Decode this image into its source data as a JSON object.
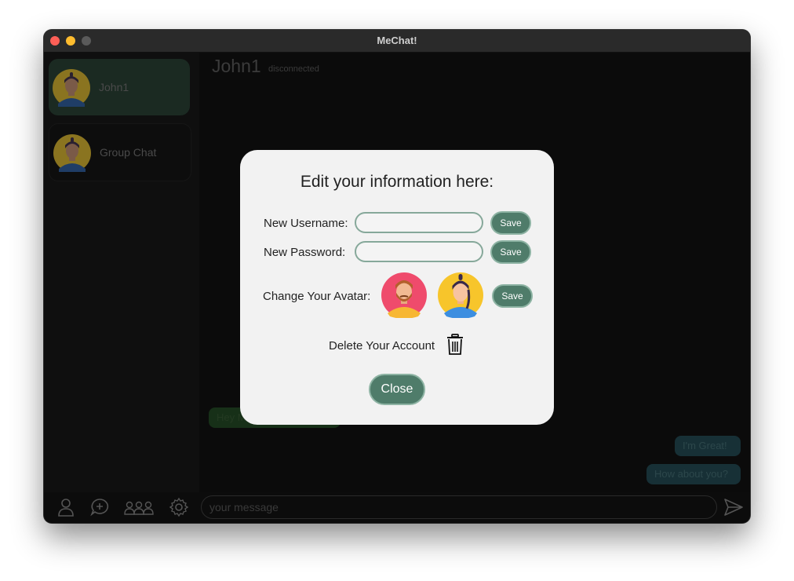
{
  "window": {
    "title": "MeChat!"
  },
  "sidebar": {
    "contacts": [
      {
        "label": "John1",
        "avatar": "man-ponytail-blue-shirt-avatar"
      },
      {
        "label": "Group Chat",
        "avatar": "man-ponytail-blue-shirt-avatar"
      }
    ]
  },
  "chat": {
    "name": "John1",
    "status": "disconnected",
    "messages": [
      {
        "text": "Hey M",
        "direction": "incoming"
      },
      {
        "text": "I'm Great!",
        "direction": "outgoing"
      },
      {
        "text": "How about you?",
        "direction": "outgoing"
      }
    ]
  },
  "bottom_bar": {
    "icons": [
      "person-icon",
      "new-chat-icon",
      "group-icon",
      "settings-gear-icon"
    ],
    "message_placeholder": "your message",
    "send_icon": "send-icon"
  },
  "modal": {
    "title": "Edit your information here:",
    "username_label": "New Username:",
    "username_value": "",
    "password_label": "New Password:",
    "password_value": "",
    "save_label": "Save",
    "avatar_label": "Change Your Avatar:",
    "avatar_options": [
      "bearded-man-yellow-hoodie-avatar",
      "man-ponytail-blue-shirt-avatar"
    ],
    "delete_label": "Delete Your Account",
    "delete_icon": "trash-icon",
    "close_label": "Close"
  },
  "colors": {
    "accent_green": "#4f7c6a",
    "accent_border": "#8db3a3",
    "modal_bg": "#f2f2f2",
    "window_bg": "#0c0c0c"
  }
}
